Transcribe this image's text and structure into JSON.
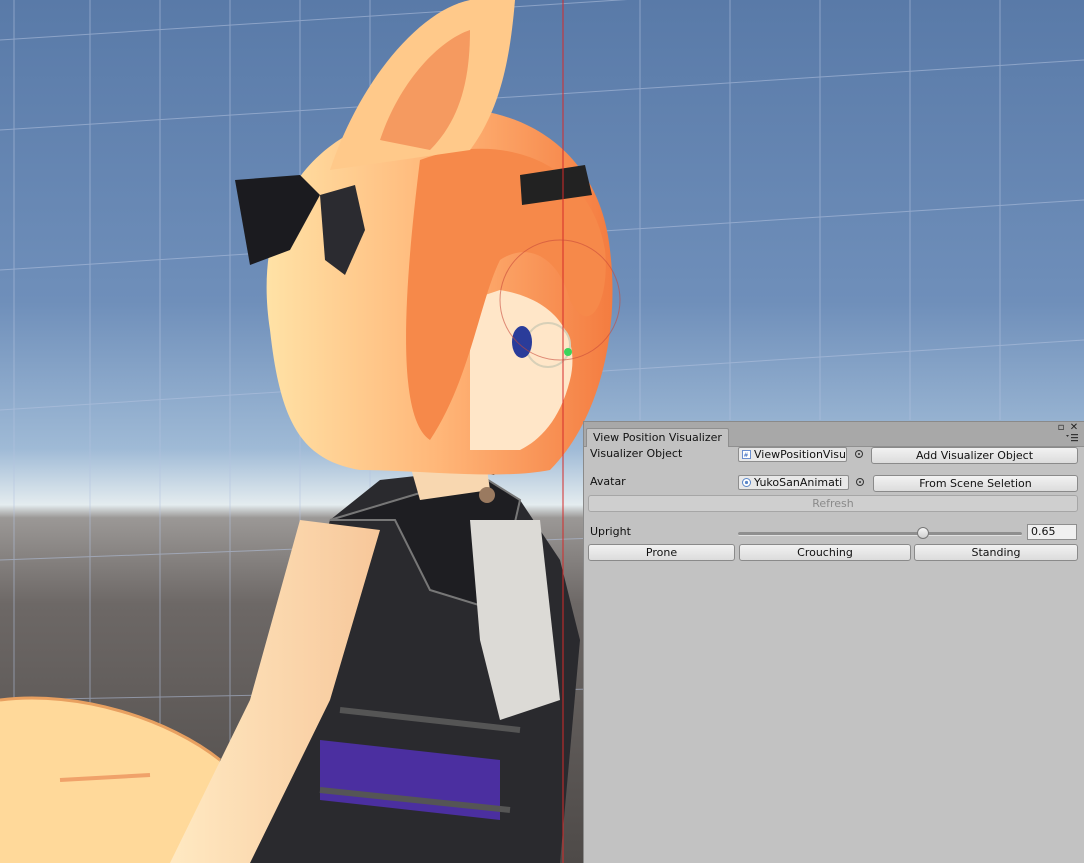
{
  "window": {
    "tab_title": "View Position Visualizer",
    "controls": {
      "maximize": "▫",
      "close": "✕",
      "menu_icon": "menu-icon"
    }
  },
  "fields": {
    "visualizer_object": {
      "label": "Visualizer Object",
      "value": "ViewPositionVisu",
      "icon": "script-icon"
    },
    "avatar": {
      "label": "Avatar",
      "value": "YukoSanAnimati",
      "icon": "prefab-icon"
    }
  },
  "buttons": {
    "add_visualizer": "Add Visualizer Object",
    "from_scene": "From Scene Seletion",
    "refresh": "Refresh",
    "prone": "Prone",
    "crouching": "Crouching",
    "standing": "Standing"
  },
  "upright": {
    "label": "Upright",
    "value": "0.65",
    "fraction": 0.65
  },
  "colors": {
    "sky_top": "#5b7aa6",
    "sky_horizon": "#dfe8ee",
    "ground": "#5a5552",
    "grid": "#a9b8d8",
    "guide_line": "#d42b2b",
    "hair": "#f79a5a",
    "panel_bg": "#c2c2c2"
  }
}
